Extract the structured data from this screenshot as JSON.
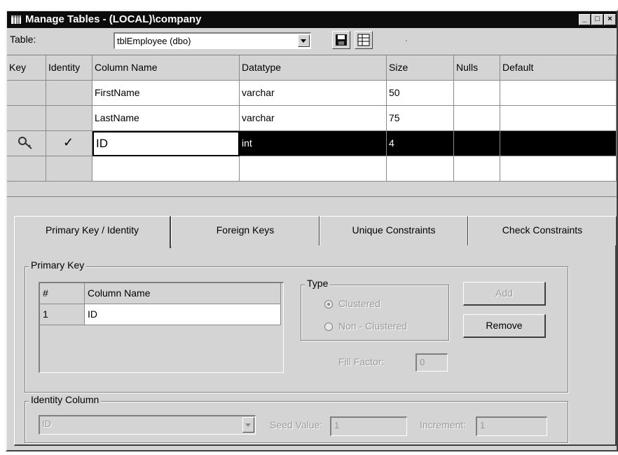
{
  "window": {
    "title": "Manage Tables - (LOCAL)\\company",
    "minimize_glyph": "_",
    "maximize_glyph": "□",
    "close_glyph": "×"
  },
  "toolbar": {
    "table_label": "Table:",
    "table_value": "tblEmployee (dbo)",
    "dot": "."
  },
  "grid": {
    "headers": [
      "Key",
      "Identity",
      "Column Name",
      "Datatype",
      "Size",
      "Nulls",
      "Default"
    ],
    "rows": [
      {
        "key": "",
        "identity": "",
        "column_name": "FirstName",
        "datatype": "varchar",
        "size": "50",
        "nulls": "",
        "default": ""
      },
      {
        "key": "",
        "identity": "",
        "column_name": "LastName",
        "datatype": "varchar",
        "size": "75",
        "nulls": "",
        "default": ""
      },
      {
        "key": "key-icon",
        "identity": "✓",
        "column_name": "ID",
        "datatype": "int",
        "size": "4",
        "nulls": "",
        "default": ""
      },
      {
        "key": "",
        "identity": "",
        "column_name": "",
        "datatype": "",
        "size": "",
        "nulls": "",
        "default": ""
      }
    ]
  },
  "tabs": [
    {
      "label": "Primary Key / Identity",
      "active": true
    },
    {
      "label": "Foreign Keys",
      "active": false
    },
    {
      "label": "Unique Constraints",
      "active": false
    },
    {
      "label": "Check Constraints",
      "active": false
    }
  ],
  "primary_key": {
    "group_label": "Primary Key",
    "headers": [
      "#",
      "Column Name"
    ],
    "rows": [
      {
        "num": "1",
        "column_name": "ID"
      }
    ],
    "type_label": "Type",
    "clustered_label": "Clustered",
    "nonclustered_label": "Non - Clustered",
    "fill_factor_label": "Fill Factor:",
    "fill_factor_value": "0",
    "add_label": "Add",
    "remove_label": "Remove"
  },
  "identity": {
    "group_label": "Identity Column",
    "column_value": "ID",
    "seed_label": "Seed Value:",
    "seed_value": "1",
    "increment_label": "Increment:",
    "increment_value": "1"
  }
}
